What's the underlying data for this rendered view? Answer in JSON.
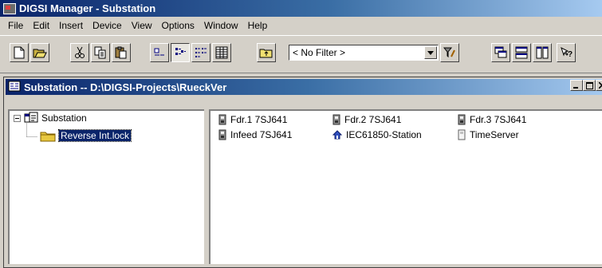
{
  "app": {
    "title": "DIGSI Manager - Substation"
  },
  "menu": [
    "File",
    "Edit",
    "Insert",
    "Device",
    "View",
    "Options",
    "Window",
    "Help"
  ],
  "toolbar": {
    "filter_value": "< No Filter >",
    "buttons": [
      "new-icon",
      "open-icon",
      "cut-icon",
      "copy-icon",
      "paste-icon",
      "large-icons-view-icon",
      "small-icons-view-icon",
      "list-view-icon",
      "details-view-icon",
      "up-one-level-icon",
      "filter-settings-icon",
      "cascade-windows-icon",
      "tile-horizontal-icon",
      "tile-vertical-icon",
      "help-icon"
    ]
  },
  "project_window": {
    "title": "Substation -- D:\\DIGSI-Projects\\RueckVer",
    "tree": {
      "root": "Substation",
      "child": "Reverse Int.lock"
    },
    "items": [
      {
        "label": "Fdr.1 7SJ641",
        "icon": "device-icon"
      },
      {
        "label": "Fdr.2 7SJ641",
        "icon": "device-icon"
      },
      {
        "label": "Fdr.3 7SJ641",
        "icon": "device-icon"
      },
      {
        "label": "Infeed 7SJ641",
        "icon": "device-icon"
      },
      {
        "label": "IEC61850-Station",
        "icon": "station-icon"
      },
      {
        "label": "TimeServer",
        "icon": "timeserver-icon"
      }
    ]
  },
  "colors": {
    "title_active": "#0a246a",
    "face": "#d4d0c8"
  }
}
